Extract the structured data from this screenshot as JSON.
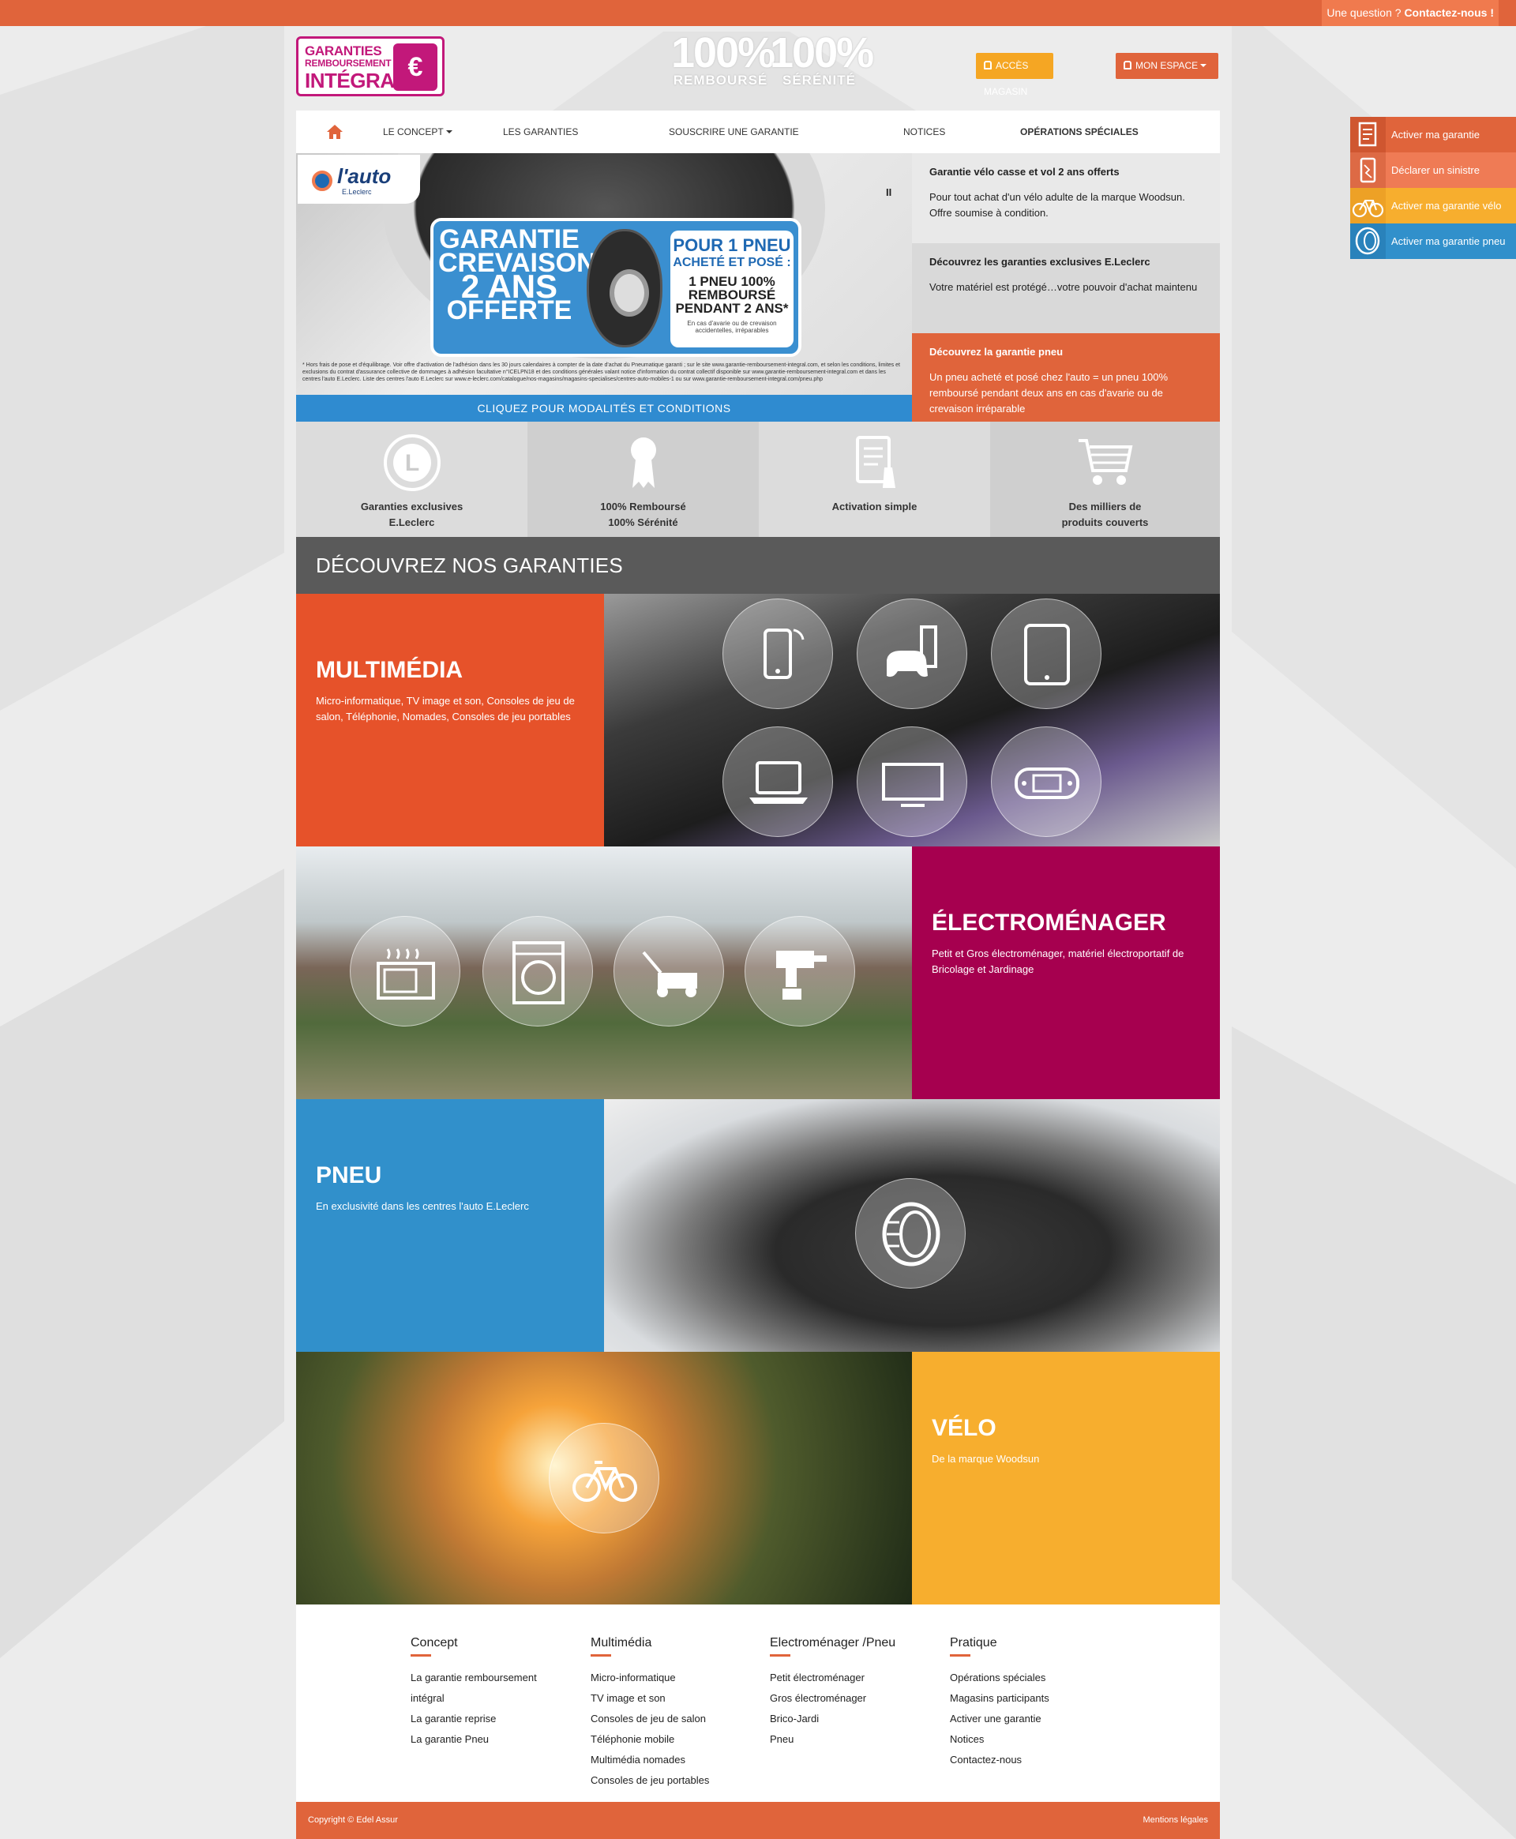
{
  "topbar": {
    "question": "Une question ?",
    "contact": "Contactez-nous !"
  },
  "logo": {
    "line1": "GARANTIES",
    "line2": "REMBOURSEMENT",
    "line3": "INTÉGRAL",
    "symbol": "€"
  },
  "slogan": {
    "left_big": "100%",
    "left_small": "REMBOURSÉ",
    "right_big": "100%",
    "right_small": "SÉRÉNITÉ"
  },
  "header_buttons": {
    "magasin": "ACCÈS MAGASIN",
    "espace": "MON ESPACE"
  },
  "nav": {
    "concept": "LE CONCEPT",
    "garanties": "LES GARANTIES",
    "souscrire": "SOUSCRIRE UNE GARANTIE",
    "notices": "NOTICES",
    "operations": "OPÉRATIONS SPÉCIALES"
  },
  "hero": {
    "brand": "l'auto",
    "brand_sub": "E.Leclerc",
    "promo_l1": "GARANTIE",
    "promo_l2": "CREVAISON",
    "promo_l3": "2 ANS",
    "promo_l4": "OFFERTE",
    "promo_r1": "POUR 1 PNEU",
    "promo_r2": "ACHETÉ ET POSÉ :",
    "promo_r3": "1 PNEU 100% REMBOURSÉ PENDANT 2 ANS*",
    "promo_r4": "En cas d'avarie ou de crevaison accidentelles, irréparables",
    "fine": "* Hors frais de pose et d'équilibrage. Voir offre d'activation de l'adhésion dans les 30 jours calendaires à compter de la date d'achat du Pneumatique garanti ; sur le site www.garantie-remboursement-integral.com, et selon les conditions, limites et exclusions du contrat d'assurance collective de dommages à adhésion facultative n°ICELPN18 et des conditions générales valant notice d'information du contrat collectif disponible sur www.garantie-remboursement-integral.com et dans les centres l'auto E.Leclerc. Liste des centres l'auto E.Leclerc sur www.e-leclerc.com/catalogue/nos-magasins/magasins-specialises/centres-auto-mobiles-1 ou sur www.garantie-remboursement-integral.com/pneu.php",
    "pause": "II",
    "cta": "CLIQUEZ POUR MODALITÉS ET CONDITIONS"
  },
  "side_blocks": [
    {
      "title": "Garantie vélo casse et vol 2 ans offerts",
      "text": "Pour tout achat d'un vélo adulte de la marque Woodsun. Offre soumise à condition."
    },
    {
      "title": "Découvrez les garanties exclusives E.Leclerc",
      "text": "Votre matériel est protégé…votre pouvoir d'achat maintenu"
    },
    {
      "title": "Découvrez la garantie pneu",
      "text": "Un pneu acheté et posé chez l'auto = un pneu 100% remboursé pendant deux ans en cas d'avarie ou de crevaison irréparable"
    }
  ],
  "features": [
    {
      "line1": "Garanties exclusives",
      "line2": "E.Leclerc",
      "icon": "leclerc-logo-icon"
    },
    {
      "line1": "100% Remboursé",
      "line2": "100% Sérénité",
      "icon": "ribbon-icon"
    },
    {
      "line1": "Activation simple",
      "line2": "",
      "icon": "form-icon"
    },
    {
      "line1": "Des milliers de",
      "line2": "produits couverts",
      "icon": "cart-icon"
    }
  ],
  "decouvrez": "DÉCOUVREZ NOS GARANTIES",
  "categories": [
    {
      "title": "MULTIMÉDIA",
      "text": "Micro-informatique, TV image et son, Consoles de jeu de salon, Téléphonie, Nomades, Consoles de jeu portables",
      "color": "#e6522a"
    },
    {
      "title": "ÉLECTROMÉNAGER",
      "text": "Petit et Gros électroménager, matériel électroportatif de Bricolage et Jardinage",
      "color": "#a6004f"
    },
    {
      "title": "PNEU",
      "text": "En exclusivité dans les centres l'auto E.Leclerc",
      "color": "#3190cb"
    },
    {
      "title": "VÉLO",
      "text": "De la marque Woodsun",
      "color": "#f7ae2e"
    }
  ],
  "footer": {
    "cols": [
      {
        "title": "Concept",
        "items": [
          "La garantie remboursement",
          "intégral",
          "La garantie reprise",
          "La garantie Pneu"
        ]
      },
      {
        "title": "Multimédia",
        "items": [
          "Micro-informatique",
          "TV image et son",
          "Consoles de jeu de salon",
          "Téléphonie mobile",
          "Multimédia nomades",
          "Consoles de jeu portables"
        ]
      },
      {
        "title": "Electroménager /Pneu",
        "items": [
          "Petit électroménager",
          "Gros électroménager",
          "Brico-Jardi",
          "Pneu"
        ]
      },
      {
        "title": "Pratique",
        "items": [
          "Opérations spéciales",
          "Magasins participants",
          "Activer une garantie",
          "Notices",
          "Contactez-nous"
        ]
      }
    ],
    "copyright": "Copyright © Edel Assur",
    "mentions": "Mentions légales"
  },
  "fixed_menu": [
    "Activer ma garantie",
    "Déclarer un sinistre",
    "Activer ma garantie vélo",
    "Activer ma garantie pneu"
  ],
  "colors": {
    "orange": "#e0643b",
    "yellow": "#f7ae2e",
    "blue": "#3190cb",
    "magenta": "#a6004f",
    "logo_pink": "#c2187a"
  }
}
